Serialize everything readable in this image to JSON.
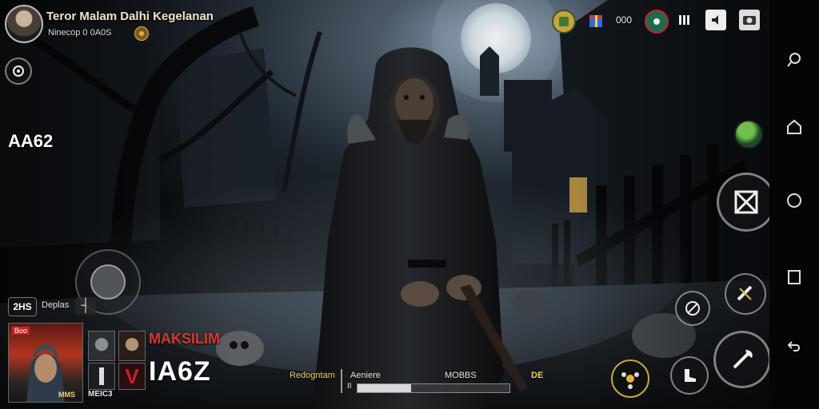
{
  "profile": {
    "title": "Teror Malam Dalhi Kegelanan",
    "subtitle": "Ninecop 0 0A0S"
  },
  "top_bar": {
    "counter": "000",
    "icons": [
      "shield-icon",
      "gift-icon",
      "counter-label",
      "badge-icon",
      "pause-icon",
      "volume-icon",
      "camera-icon"
    ]
  },
  "left_hud": {
    "score": "AA62",
    "mini_label": "2HS",
    "mini_text": "Deplas"
  },
  "cards": {
    "title": "MAKSILIM",
    "big_label": "IA6Z",
    "sub_label": "MEIC3",
    "card_badge": "Boo",
    "big_card_caption": "MMS"
  },
  "status_bar": {
    "left_label": "Redogntam",
    "center_label": "Aeniere",
    "right_label": "MOBBS",
    "tag": "DE",
    "progress": 0.35,
    "progress_marker": "II"
  },
  "colors": {
    "accent_gold": "#e0b341",
    "accent_red": "#c8202a",
    "progress_fill": "#d8d8d8"
  }
}
